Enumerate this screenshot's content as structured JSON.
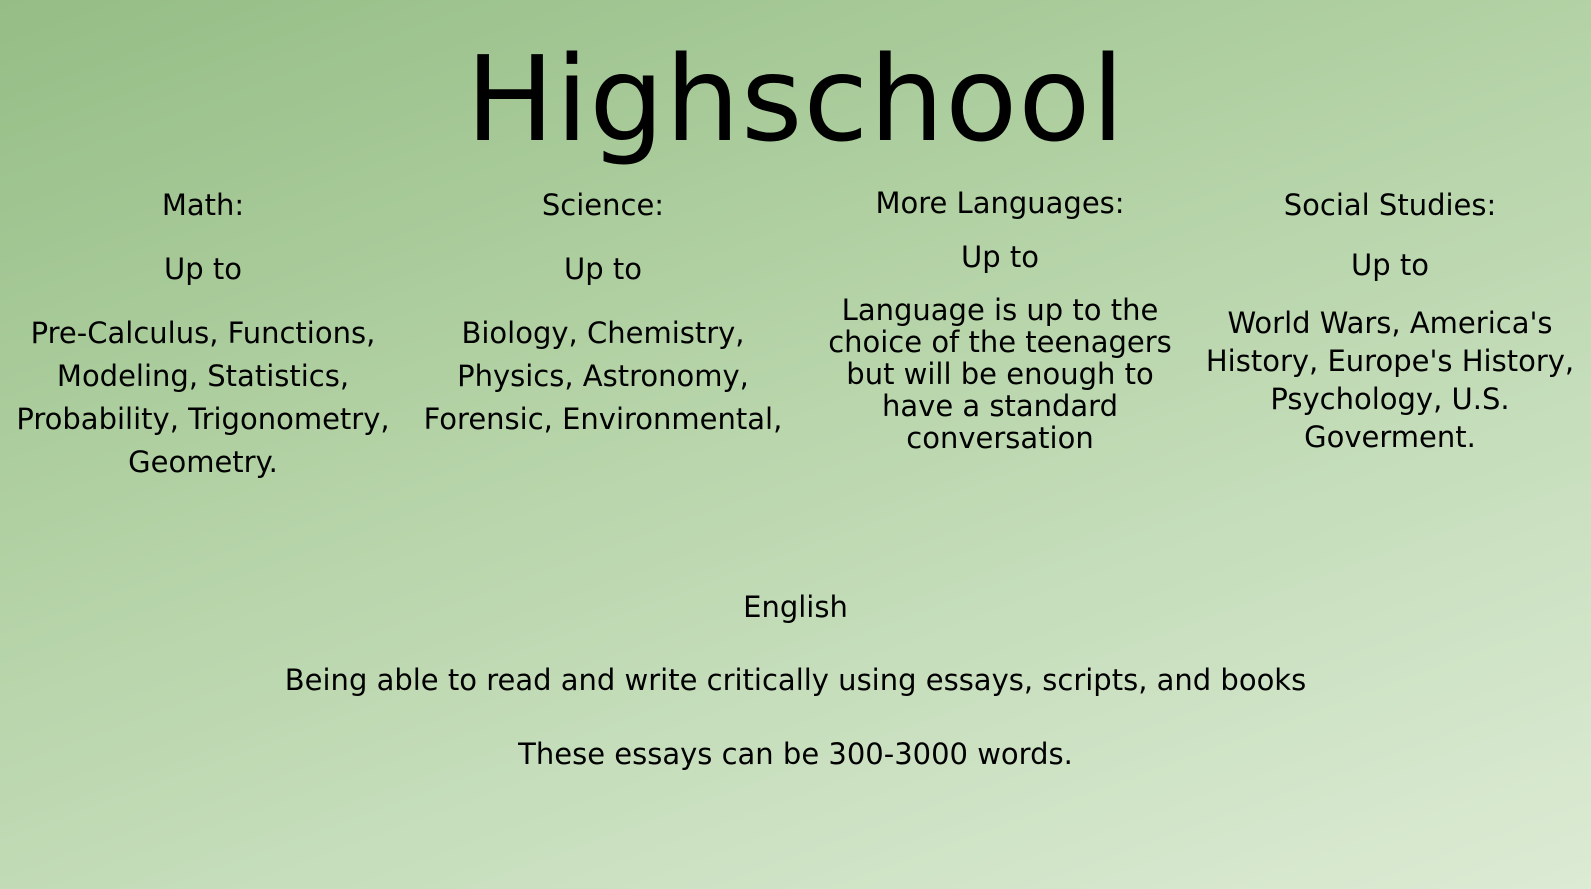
{
  "title": "Highschool",
  "columns": [
    {
      "heading": "Math:",
      "up_to": "Up to",
      "body": "Pre-Calculus, Functions, Modeling, Statistics, Probability, Trigonometry, Geometry."
    },
    {
      "heading": "Science:",
      "up_to": "Up to",
      "body": "Biology, Chemistry, Physics, Astronomy, Forensic, Environmental,"
    },
    {
      "heading": "More Languages:",
      "up_to": "Up to",
      "body": "Language is up to the choice of the teenagers but will be enough to have a standard conversation"
    },
    {
      "heading": "Social Studies:",
      "up_to": "Up to",
      "body": "World Wars, America's History, Europe's History, Psychology, U.S. Goverment."
    }
  ],
  "english": {
    "heading": "English",
    "line1": "Being able to read and write critically using essays, scripts, and books",
    "line2": "These essays can be 300-3000 words."
  },
  "colors": {
    "background_start": "#95bd85",
    "background_end": "#dcebd4",
    "text": "#000000"
  }
}
